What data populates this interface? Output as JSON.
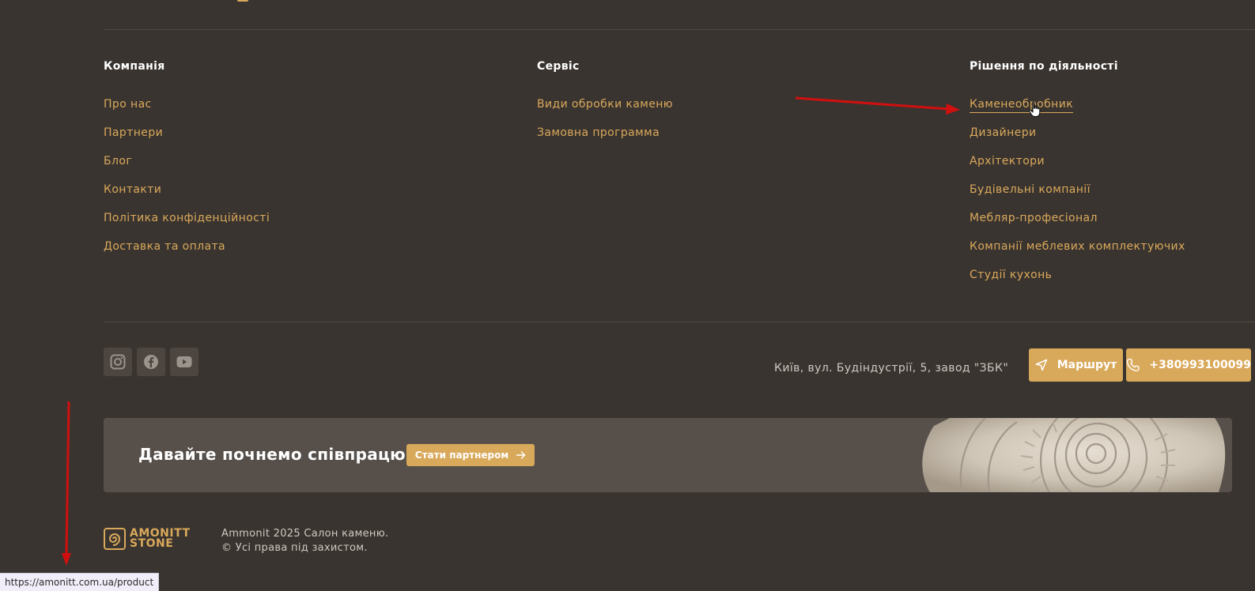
{
  "columns": [
    {
      "title": "Компанія",
      "links": [
        "Про нас",
        "Партнери",
        "Блог",
        "Контакти",
        "Політика конфіденційності",
        "Доставка та оплата"
      ]
    },
    {
      "title": "Сервіс",
      "links": [
        "Види обробки каменю",
        "Замовна программа"
      ]
    },
    {
      "title": "Рішення по діяльності",
      "links": [
        "Каменеобробник",
        "Дизайнери",
        "Архітектори",
        "Будівельні компанії",
        "Мебляр-професіонал",
        "Компанії меблевих комплектуючих",
        "Студії кухонь"
      ]
    }
  ],
  "social": [
    "instagram-icon",
    "facebook-icon",
    "youtube-icon"
  ],
  "contact": {
    "address": "Київ, вул. Будіндустрії, 5, завод \"ЗБК\"",
    "route_label": "Маршрут",
    "phone_label": "+380993100099"
  },
  "banner": {
    "title": "Давайте почнемо співпрацю",
    "cta_label": "Стати партнером"
  },
  "logo": {
    "line1": "AMONITT",
    "line2": "STONE"
  },
  "copyright": {
    "line1": "Ammonit 2025 Салон каменю.",
    "line2": "© Усі права під захистом."
  },
  "status_url": "https://amonitt.com.ua/product",
  "colors": {
    "accent": "#d9a95b",
    "background": "#3a3430",
    "banner": "#57504a",
    "annotation": "#d10f0f"
  }
}
